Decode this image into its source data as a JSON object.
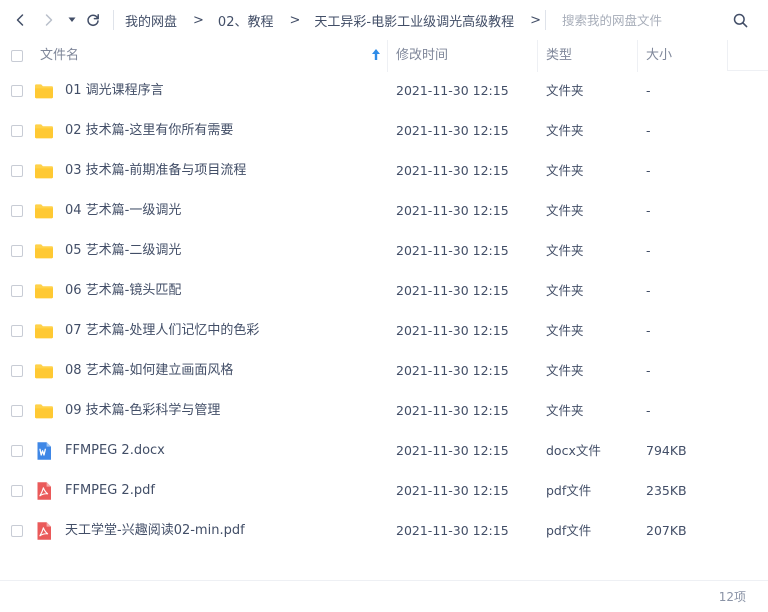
{
  "toolbar": {
    "back_icon": "chevron-left-icon",
    "forward_icon": "chevron-right-icon",
    "history_icon": "caret-down-icon",
    "refresh_icon": "refresh-icon"
  },
  "breadcrumb": {
    "items": [
      "我的网盘",
      "02、教程",
      "天工异彩-电影工业级调光高级教程"
    ],
    "separator": ">"
  },
  "search": {
    "placeholder": "搜索我的网盘文件",
    "icon": "search-icon"
  },
  "table": {
    "columns": {
      "name": "文件名",
      "modified": "修改时间",
      "type": "类型",
      "size": "大小"
    },
    "sort": {
      "column": "文件名",
      "direction": "ascending"
    },
    "rows": [
      {
        "icon": "folder-icon",
        "name": "01 调光课程序言",
        "modified": "2021-11-30 12:15",
        "type": "文件夹",
        "size": "-"
      },
      {
        "icon": "folder-icon",
        "name": "02 技术篇-这里有你所有需要",
        "modified": "2021-11-30 12:15",
        "type": "文件夹",
        "size": "-"
      },
      {
        "icon": "folder-icon",
        "name": "03 技术篇-前期准备与项目流程",
        "modified": "2021-11-30 12:15",
        "type": "文件夹",
        "size": "-"
      },
      {
        "icon": "folder-icon",
        "name": "04 艺术篇-一级调光",
        "modified": "2021-11-30 12:15",
        "type": "文件夹",
        "size": "-"
      },
      {
        "icon": "folder-icon",
        "name": "05 艺术篇-二级调光",
        "modified": "2021-11-30 12:15",
        "type": "文件夹",
        "size": "-"
      },
      {
        "icon": "folder-icon",
        "name": "06 艺术篇-镜头匹配",
        "modified": "2021-11-30 12:15",
        "type": "文件夹",
        "size": "-"
      },
      {
        "icon": "folder-icon",
        "name": "07 艺术篇-处理人们记忆中的色彩",
        "modified": "2021-11-30 12:15",
        "type": "文件夹",
        "size": "-"
      },
      {
        "icon": "folder-icon",
        "name": "08 艺术篇-如何建立画面风格",
        "modified": "2021-11-30 12:15",
        "type": "文件夹",
        "size": "-"
      },
      {
        "icon": "folder-icon",
        "name": "09 技术篇-色彩科学与管理",
        "modified": "2021-11-30 12:15",
        "type": "文件夹",
        "size": "-"
      },
      {
        "icon": "word-doc-icon",
        "name": "FFMPEG 2.docx",
        "modified": "2021-11-30 12:15",
        "type": "docx文件",
        "size": "794KB"
      },
      {
        "icon": "pdf-icon",
        "name": "FFMPEG 2.pdf",
        "modified": "2021-11-30 12:15",
        "type": "pdf文件",
        "size": "235KB"
      },
      {
        "icon": "pdf-icon",
        "name": "天工学堂-兴趣阅读02-min.pdf",
        "modified": "2021-11-30 12:15",
        "type": "pdf文件",
        "size": "207KB"
      }
    ]
  },
  "footer": {
    "count_text": "12项"
  },
  "colors": {
    "text": "#424e67",
    "header_text": "#7f879a",
    "muted": "#a7adb9",
    "folder": "#ffd24a",
    "word_blue": "#3f87e6",
    "pdf_red": "#ea5a5a",
    "sort_accent": "#2e8ce8",
    "divider": "#eef0f4"
  }
}
